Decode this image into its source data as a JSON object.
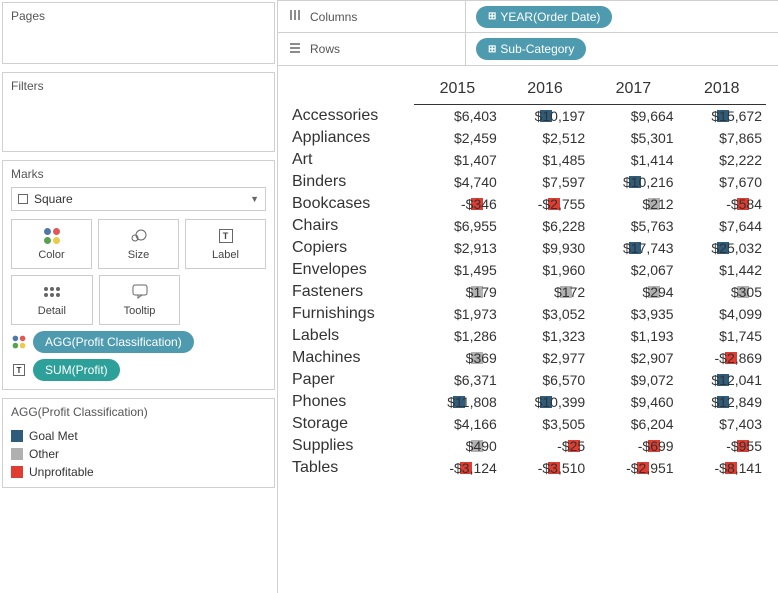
{
  "cards": {
    "pages": "Pages",
    "filters": "Filters",
    "marks": "Marks"
  },
  "marks": {
    "type": "Square",
    "buttons": {
      "color": "Color",
      "size": "Size",
      "label": "Label",
      "detail": "Detail",
      "tooltip": "Tooltip"
    },
    "encodings": {
      "color": "AGG(Profit Classification)",
      "label": "SUM(Profit)"
    }
  },
  "legend": {
    "title": "AGG(Profit Classification)",
    "items": [
      {
        "label": "Goal Met",
        "color": "#2e5c7a"
      },
      {
        "label": "Other",
        "color": "#b0b0b0"
      },
      {
        "label": "Unprofitable",
        "color": "#e03c31"
      }
    ]
  },
  "shelves": {
    "columns_label": "Columns",
    "rows_label": "Rows",
    "columns_pill": "YEAR(Order Date)",
    "rows_pill": "Sub-Category"
  },
  "viz": {
    "years": [
      "2015",
      "2016",
      "2017",
      "2018"
    ],
    "rows": [
      {
        "hdr": "Accessories",
        "cells": [
          {
            "v": "$6,403",
            "c": null
          },
          {
            "v": "$10,197",
            "c": "#2e5c7a"
          },
          {
            "v": "$9,664",
            "c": null
          },
          {
            "v": "$15,672",
            "c": "#2e5c7a"
          }
        ]
      },
      {
        "hdr": "Appliances",
        "cells": [
          {
            "v": "$2,459",
            "c": null
          },
          {
            "v": "$2,512",
            "c": null
          },
          {
            "v": "$5,301",
            "c": null
          },
          {
            "v": "$7,865",
            "c": null
          }
        ]
      },
      {
        "hdr": "Art",
        "cells": [
          {
            "v": "$1,407",
            "c": null
          },
          {
            "v": "$1,485",
            "c": null
          },
          {
            "v": "$1,414",
            "c": null
          },
          {
            "v": "$2,222",
            "c": null
          }
        ]
      },
      {
        "hdr": "Binders",
        "cells": [
          {
            "v": "$4,740",
            "c": null
          },
          {
            "v": "$7,597",
            "c": null
          },
          {
            "v": "$10,216",
            "c": "#2e5c7a"
          },
          {
            "v": "$7,670",
            "c": null
          }
        ]
      },
      {
        "hdr": "Bookcases",
        "cells": [
          {
            "v": "-$346",
            "c": "#e03c31"
          },
          {
            "v": "-$2,755",
            "c": "#e03c31"
          },
          {
            "v": "$212",
            "c": "#b0b0b0"
          },
          {
            "v": "-$584",
            "c": "#e03c31"
          }
        ]
      },
      {
        "hdr": "Chairs",
        "cells": [
          {
            "v": "$6,955",
            "c": null
          },
          {
            "v": "$6,228",
            "c": null
          },
          {
            "v": "$5,763",
            "c": null
          },
          {
            "v": "$7,644",
            "c": null
          }
        ]
      },
      {
        "hdr": "Copiers",
        "cells": [
          {
            "v": "$2,913",
            "c": null
          },
          {
            "v": "$9,930",
            "c": null
          },
          {
            "v": "$17,743",
            "c": "#2e5c7a"
          },
          {
            "v": "$25,032",
            "c": "#2e5c7a"
          }
        ]
      },
      {
        "hdr": "Envelopes",
        "cells": [
          {
            "v": "$1,495",
            "c": null
          },
          {
            "v": "$1,960",
            "c": null
          },
          {
            "v": "$2,067",
            "c": null
          },
          {
            "v": "$1,442",
            "c": null
          }
        ]
      },
      {
        "hdr": "Fasteners",
        "cells": [
          {
            "v": "$179",
            "c": "#b0b0b0"
          },
          {
            "v": "$172",
            "c": "#b0b0b0"
          },
          {
            "v": "$294",
            "c": "#b0b0b0"
          },
          {
            "v": "$305",
            "c": "#b0b0b0"
          }
        ]
      },
      {
        "hdr": "Furnishings",
        "cells": [
          {
            "v": "$1,973",
            "c": null
          },
          {
            "v": "$3,052",
            "c": null
          },
          {
            "v": "$3,935",
            "c": null
          },
          {
            "v": "$4,099",
            "c": null
          }
        ]
      },
      {
        "hdr": "Labels",
        "cells": [
          {
            "v": "$1,286",
            "c": null
          },
          {
            "v": "$1,323",
            "c": null
          },
          {
            "v": "$1,193",
            "c": null
          },
          {
            "v": "$1,745",
            "c": null
          }
        ]
      },
      {
        "hdr": "Machines",
        "cells": [
          {
            "v": "$369",
            "c": "#b0b0b0"
          },
          {
            "v": "$2,977",
            "c": null
          },
          {
            "v": "$2,907",
            "c": null
          },
          {
            "v": "-$2,869",
            "c": "#e03c31"
          }
        ]
      },
      {
        "hdr": "Paper",
        "cells": [
          {
            "v": "$6,371",
            "c": null
          },
          {
            "v": "$6,570",
            "c": null
          },
          {
            "v": "$9,072",
            "c": null
          },
          {
            "v": "$12,041",
            "c": "#2e5c7a"
          }
        ]
      },
      {
        "hdr": "Phones",
        "cells": [
          {
            "v": "$11,808",
            "c": "#2e5c7a"
          },
          {
            "v": "$10,399",
            "c": "#2e5c7a"
          },
          {
            "v": "$9,460",
            "c": null
          },
          {
            "v": "$12,849",
            "c": "#2e5c7a"
          }
        ]
      },
      {
        "hdr": "Storage",
        "cells": [
          {
            "v": "$4,166",
            "c": null
          },
          {
            "v": "$3,505",
            "c": null
          },
          {
            "v": "$6,204",
            "c": null
          },
          {
            "v": "$7,403",
            "c": null
          }
        ]
      },
      {
        "hdr": "Supplies",
        "cells": [
          {
            "v": "$490",
            "c": "#b0b0b0"
          },
          {
            "v": "-$25",
            "c": "#e03c31"
          },
          {
            "v": "-$699",
            "c": "#e03c31"
          },
          {
            "v": "-$955",
            "c": "#e03c31"
          }
        ]
      },
      {
        "hdr": "Tables",
        "cells": [
          {
            "v": "-$3,124",
            "c": "#e03c31"
          },
          {
            "v": "-$3,510",
            "c": "#e03c31"
          },
          {
            "v": "-$2,951",
            "c": "#e03c31"
          },
          {
            "v": "-$8,141",
            "c": "#e03c31"
          }
        ]
      }
    ]
  }
}
